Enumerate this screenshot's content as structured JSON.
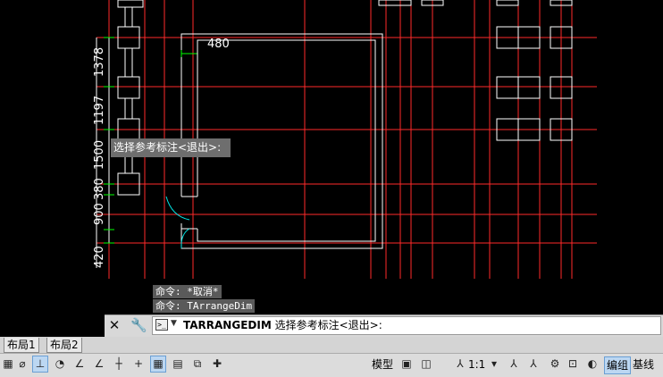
{
  "drawing": {
    "dimension_labels": [
      "1378",
      "1197",
      "1500",
      "380",
      "900",
      "420",
      "480"
    ],
    "tooltip": "选择参考标注<退出>:",
    "colors": {
      "grid": "#ff2a2a",
      "wall": "#ffffff",
      "dimension": "#00ff00",
      "door": "#00e5e5"
    }
  },
  "command_history": [
    "命令: *取消*",
    "命令: TArrangeDim"
  ],
  "command_line": {
    "command": "TARRANGEDIM",
    "prompt": "选择参考标注<退出>:",
    "close_icon": "close-icon",
    "settings_icon": "wrench-icon"
  },
  "layout_tabs": [
    "布局1",
    "布局2"
  ],
  "statusbar": {
    "model_label": "模型",
    "scale_label": "1:1",
    "edit_group_label": "编组",
    "baseline_label": "基线"
  }
}
